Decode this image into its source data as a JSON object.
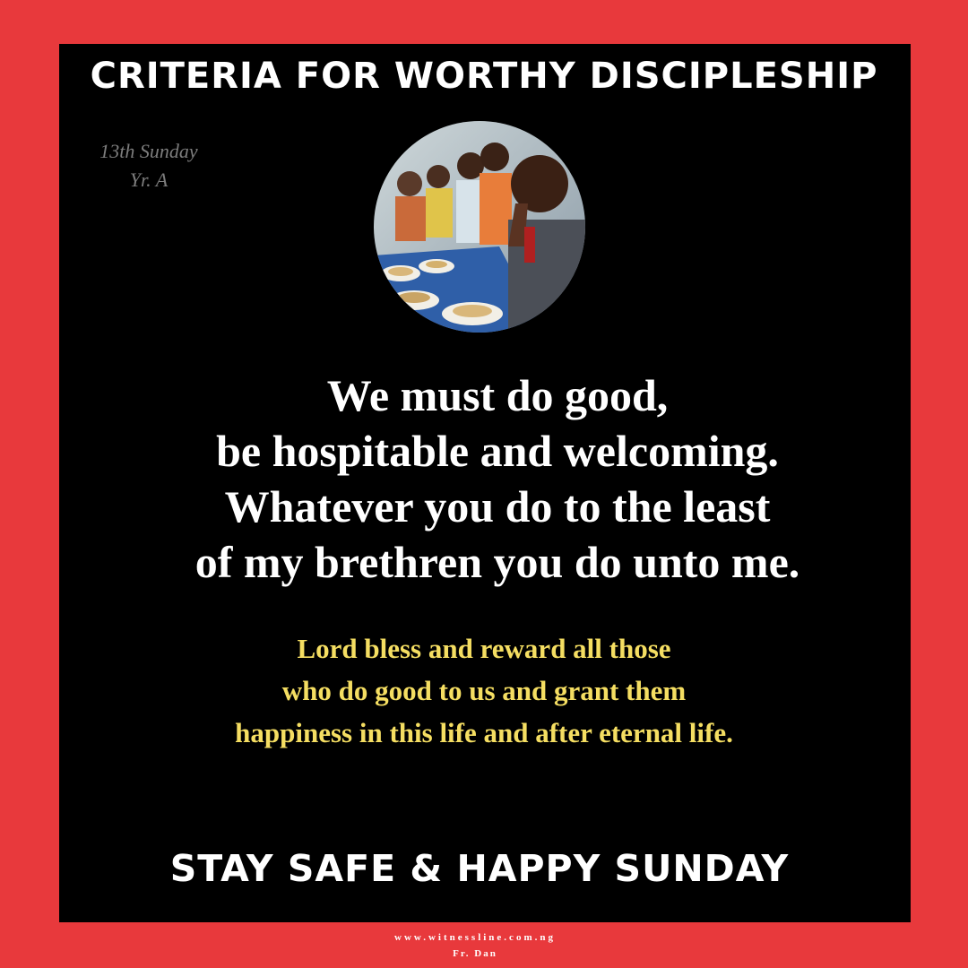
{
  "title": "CRITERIA FOR WORTHY DISCIPLESHIP",
  "occasion": {
    "line1": "13th Sunday",
    "line2": "Yr. A"
  },
  "photo": {
    "description_icon": "praying-child-photo"
  },
  "main_quote": {
    "lines": [
      "We must do good,",
      "be hospitable and welcoming.",
      "Whatever you do to the least",
      "of my brethren you do unto me."
    ]
  },
  "prayer": {
    "lines": [
      "Lord bless and reward all those",
      "who do good to us and grant them",
      "happiness in this life and after eternal life."
    ]
  },
  "closing": "STAY SAFE & HAPPY SUNDAY",
  "footer": {
    "website": "www.witnessline.com.ng",
    "author": "Fr. Dan"
  },
  "colors": {
    "frame": "#e8393c",
    "panel": "#000000",
    "main_text": "#ffffff",
    "prayer_text": "#f5de62",
    "occasion_text": "#7d7d7d"
  }
}
